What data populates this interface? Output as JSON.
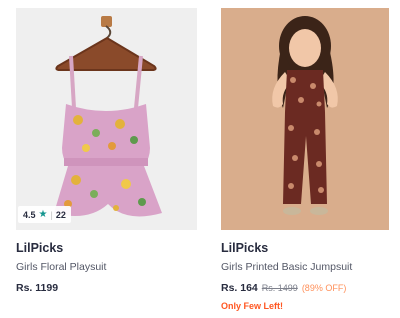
{
  "products": [
    {
      "rating": "4.5",
      "rating_count": "22",
      "rating_icon": "star-icon",
      "brand": "LilPicks",
      "name": "Girls Floral Playsuit",
      "price": "Rs. 1199"
    },
    {
      "brand": "LilPicks",
      "name": "Girls Printed Basic Jumpsuit",
      "price": "Rs. 164",
      "mrp": "Rs. 1499",
      "discount": "(89% OFF)",
      "stock_note": "Only Few Left!"
    }
  ],
  "colors": {
    "accent_star": "#14958f",
    "discount": "#ff905a",
    "stock_warning": "#ff5722"
  }
}
